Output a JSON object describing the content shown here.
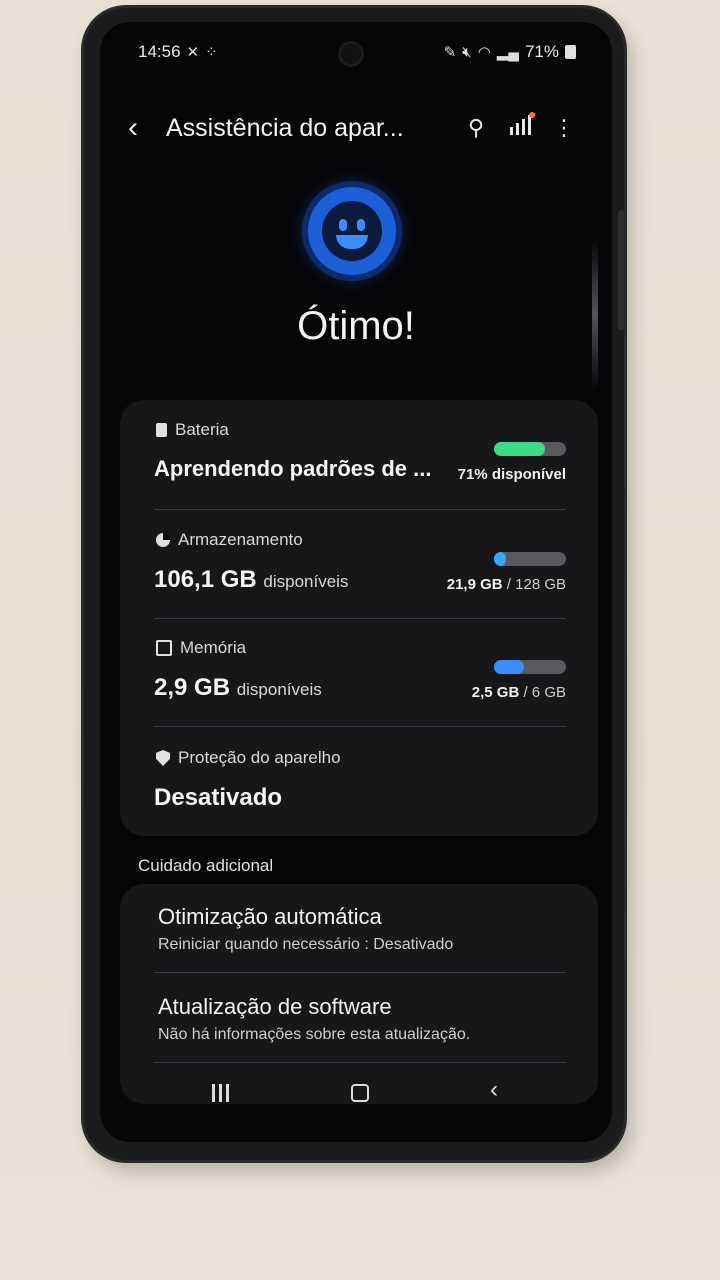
{
  "status_bar": {
    "time": "14:56",
    "battery_percent": "71%"
  },
  "header": {
    "title": "Assistência do apar...",
    "back_icon": "back-arrow-icon",
    "search_icon": "search-icon",
    "diagnostics_icon": "signal-bars-icon",
    "more_icon": "more-vertical-icon"
  },
  "overall": {
    "status": "Ótimo!",
    "icon": "smiley-face-icon"
  },
  "items": {
    "battery": {
      "label": "Bateria",
      "value": "Aprendendo padrões de ...",
      "right_text": "71% disponível",
      "level": 0.71,
      "bar_color": "#3ddc84"
    },
    "storage": {
      "label": "Armazenamento",
      "value": "106,1 GB",
      "unit": "disponíveis",
      "used": "21,9 GB",
      "total": "/ 128 GB",
      "level": 0.17,
      "bar_color": "#35a8ff"
    },
    "memory": {
      "label": "Memória",
      "value": "2,9 GB",
      "unit": "disponíveis",
      "used": "2,5 GB",
      "total": "/ 6 GB",
      "level": 0.42,
      "bar_color": "#3a8dff"
    },
    "protection": {
      "label": "Proteção do aparelho",
      "value": "Desativado"
    }
  },
  "additional": {
    "section_title": "Cuidado adicional",
    "auto_opt": {
      "title": "Otimização automática",
      "subtitle": "Reiniciar quando necessário : Desativado"
    },
    "software": {
      "title": "Atualização de software",
      "subtitle": "Não há informações sobre esta atualização."
    }
  },
  "colors": {
    "accent": "#1d5ed9",
    "background": "#060608",
    "card": "#17171a"
  }
}
